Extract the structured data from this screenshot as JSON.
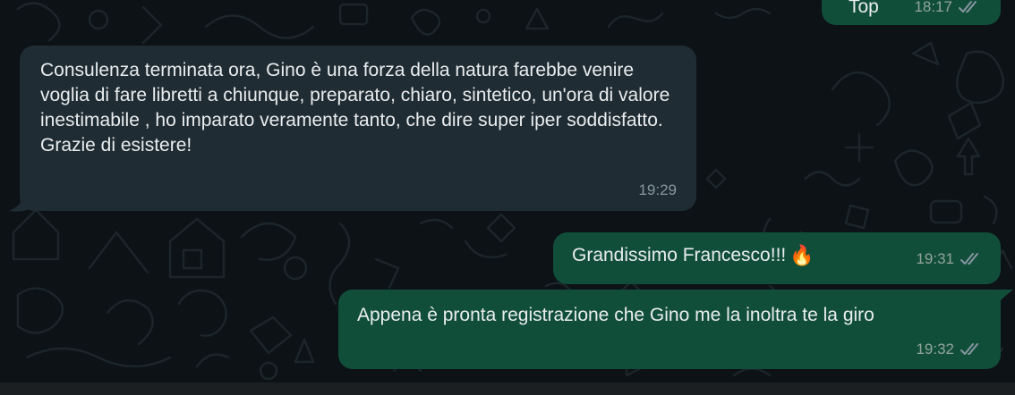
{
  "messages": [
    {
      "direction": "outgoing",
      "text": "Top",
      "time": "18:17",
      "status": "read"
    },
    {
      "direction": "incoming",
      "text": "Consulenza terminata ora, Gino è una forza della natura farebbe venire voglia di fare libretti a chiunque, preparato, chiaro, sintetico, un'ora di valore inestimabile , ho imparato veramente tanto, che dire super iper soddisfatto. Grazie di esistere!",
      "time": "19:29"
    },
    {
      "direction": "outgoing",
      "text": "Grandissimo Francesco!!!",
      "emoji": "🔥",
      "time": "19:31",
      "status": "read"
    },
    {
      "direction": "outgoing",
      "text": "Appena è pronta registrazione che Gino me la inoltra te la giro",
      "time": "19:32",
      "status": "read"
    }
  ],
  "theme": {
    "background": "#0c1216",
    "incoming_bubble": "#202c33",
    "outgoing_bubble": "#114e3a",
    "text": "#e9edef",
    "meta": "#8696a0",
    "tick_icon": "double-check-icon"
  }
}
